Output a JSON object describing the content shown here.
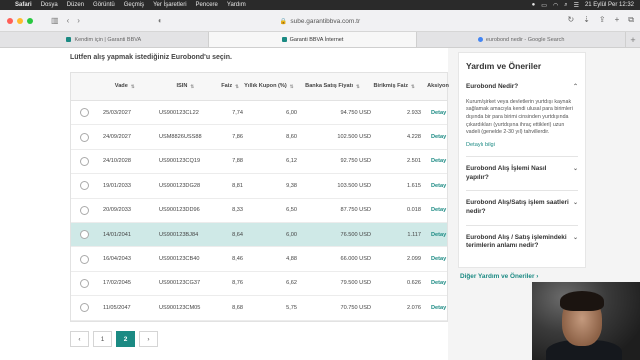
{
  "menubar": {
    "apple": "",
    "app": "Safari",
    "items": [
      "Dosya",
      "Düzen",
      "Görüntü",
      "Geçmiş",
      "Yer İşaretleri",
      "Pencere",
      "Yardım"
    ],
    "clock": "21 Eylül Per  12:32"
  },
  "toolbar": {
    "url": "sube.garantibbva.com.tr"
  },
  "tabs": [
    {
      "label": "Kendim için | Garanti BBVA"
    },
    {
      "label": "Garanti BBVA İnternet"
    },
    {
      "label": "eurobond nedir - Google Search"
    }
  ],
  "main": {
    "instruction": "Lütfen alış yapmak istediğiniz Eurobond'u seçin.",
    "columns": [
      "Vade",
      "ISIN",
      "Faiz",
      "Yıllık Kupon (%)",
      "Banka Satış Fiyatı",
      "Birikmiş Faiz",
      "Aksiyon"
    ],
    "rows": [
      {
        "vade": "25/03/2027",
        "isin": "US900123CL22",
        "faiz": "7,74",
        "kupon": "6,00",
        "fiyat": "94.750 USD",
        "birikmis": "2.933",
        "aksiyon": "Detay"
      },
      {
        "vade": "24/09/2027",
        "isin": "USM8826USS88",
        "faiz": "7,86",
        "kupon": "8,60",
        "fiyat": "102.500 USD",
        "birikmis": "4.228",
        "aksiyon": "Detay"
      },
      {
        "vade": "24/10/2028",
        "isin": "US900123CQ19",
        "faiz": "7,88",
        "kupon": "6,12",
        "fiyat": "92.750 USD",
        "birikmis": "2.501",
        "aksiyon": "Detay"
      },
      {
        "vade": "19/01/2033",
        "isin": "US900123DG28",
        "faiz": "8,81",
        "kupon": "9,38",
        "fiyat": "103.500 USD",
        "birikmis": "1.615",
        "aksiyon": "Detay"
      },
      {
        "vade": "20/09/2033",
        "isin": "US900123DD96",
        "faiz": "8,33",
        "kupon": "6,50",
        "fiyat": "87.750 USD",
        "birikmis": "0.018",
        "aksiyon": "Detay"
      },
      {
        "vade": "14/01/2041",
        "isin": "US900123BJ84",
        "faiz": "8,64",
        "kupon": "6,00",
        "fiyat": "76.500 USD",
        "birikmis": "1.117",
        "aksiyon": "Detay",
        "highlight": true
      },
      {
        "vade": "16/04/2043",
        "isin": "US900123CB40",
        "faiz": "8,46",
        "kupon": "4,88",
        "fiyat": "66.000 USD",
        "birikmis": "2.099",
        "aksiyon": "Detay"
      },
      {
        "vade": "17/02/2045",
        "isin": "US900123CG37",
        "faiz": "8,76",
        "kupon": "6,62",
        "fiyat": "79.500 USD",
        "birikmis": "0.626",
        "aksiyon": "Detay"
      },
      {
        "vade": "11/05/2047",
        "isin": "US900123CM05",
        "faiz": "8,68",
        "kupon": "5,75",
        "fiyat": "70.750 USD",
        "birikmis": "2.076",
        "aksiyon": "Detay"
      }
    ],
    "pagination": {
      "prev": "‹",
      "pages": [
        "1",
        "2"
      ],
      "active": "2",
      "next": "›"
    }
  },
  "help": {
    "title": "Yardım ve Öneriler",
    "items": [
      {
        "q": "Eurobond Nedir?",
        "open": true,
        "body": "Kurum/şirket veya devletlerin yurtdışı kaynak sağlamak amacıyla kendi ulusal para birimleri dışında bir para birimi cinsinden yurtdışında çıkardıkları (yurtdışına ihraç ettikleri) uzun vadeli (genelde 2-30 yıl) tahvillerdir.",
        "link": "Detaylı bilgi"
      },
      {
        "q": "Eurobond Alış İşlemi Nasıl yapılır?"
      },
      {
        "q": "Eurobond Alış/Satış işlem saatleri nedir?"
      },
      {
        "q": "Eurobond Alış / Satış işlemindeki terimlerin anlamı nedir?"
      }
    ],
    "other": "Diğer Yardım ve Öneriler  ›"
  },
  "colors": {
    "accent": "#1b8a83",
    "highlight_row": "#cfe9e7"
  }
}
